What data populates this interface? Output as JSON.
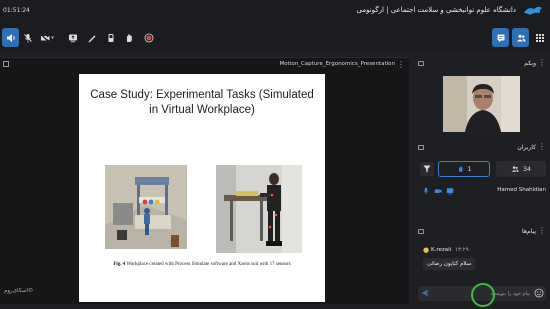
{
  "header": {
    "timer": "01:51:24",
    "room_title": "دانشگاه علوم توانبخشی و سلامت اجتماعی | ارگونومی"
  },
  "toolbar": {
    "left_buttons": [
      "speaker-icon",
      "mic-off-icon",
      "camera-off-icon",
      "share-screen-icon",
      "draw-icon",
      "clear-icon",
      "raise-hand-icon",
      "record-icon"
    ],
    "right_buttons": [
      "chat-icon",
      "users-icon",
      "grid-icon"
    ],
    "accent": "#2f6fb5"
  },
  "presentation": {
    "file_name": "Motion_Capture_Ergonomics_Presentation",
    "slide_title_line1": "Case Study: Experimental Tasks (Simulated",
    "slide_title_line2": "in Virtual Workplace)",
    "caption_bold": "Fig. 4",
    "caption_text": " Workplace created with Process Simulate software and Xsens suit with 17 sensors"
  },
  "watermark": "©اسکای‌روم",
  "webcam": {
    "title": "وبکم"
  },
  "users": {
    "title": "کاربران",
    "raised_count": "1",
    "total_count": "34",
    "user_name": "Hamed Shahidian"
  },
  "chat": {
    "title": "پیام‌ها",
    "sender": "K.rezaii",
    "time": "۱۳:۲۹",
    "message": "سلام کتایون رضائی",
    "input_placeholder": "پیام خود را بنویسید"
  }
}
